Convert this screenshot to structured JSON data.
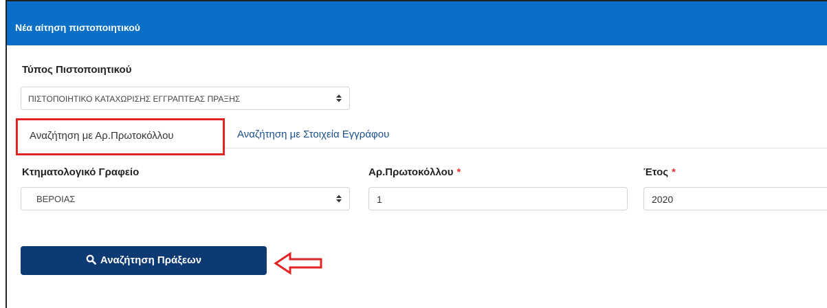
{
  "panel": {
    "title": "Νέα αίτηση πιστοποιητικού"
  },
  "certificate_type": {
    "label": "Τύπος Πιστοποιητικού",
    "selected": "ΠΙΣΤΟΠΟΙΗΤΙΚΟ ΚΑΤΑΧΩΡΙΣΗΣ ΕΓΓΡΑΠΤΕΑΣ ΠΡΑΞΗΣ"
  },
  "tabs": [
    {
      "label": "Αναζήτηση με Αρ.Πρωτοκόλλου",
      "active": true
    },
    {
      "label": "Αναζήτηση με Στοιχεία Εγγράφου",
      "active": false
    }
  ],
  "fields": {
    "office": {
      "label": "Κτηματολογικό Γραφείο",
      "value": "ΒΕΡΟΙΑΣ"
    },
    "protocol": {
      "label": "Αρ.Πρωτοκόλλου",
      "required_mark": "*",
      "value": "1"
    },
    "year": {
      "label": "Έτος",
      "required_mark": "*",
      "value": "2020"
    }
  },
  "actions": {
    "search_label": "Αναζήτηση Πράξεων"
  },
  "colors": {
    "header": "#0a6fc7",
    "button": "#0d3a72",
    "highlight": "#e02424",
    "required": "#e03030",
    "link": "#1a4f8b"
  },
  "icons": {
    "search": "search-icon",
    "caret": "sort-caret-icon",
    "pointer": "left-arrow-icon"
  }
}
